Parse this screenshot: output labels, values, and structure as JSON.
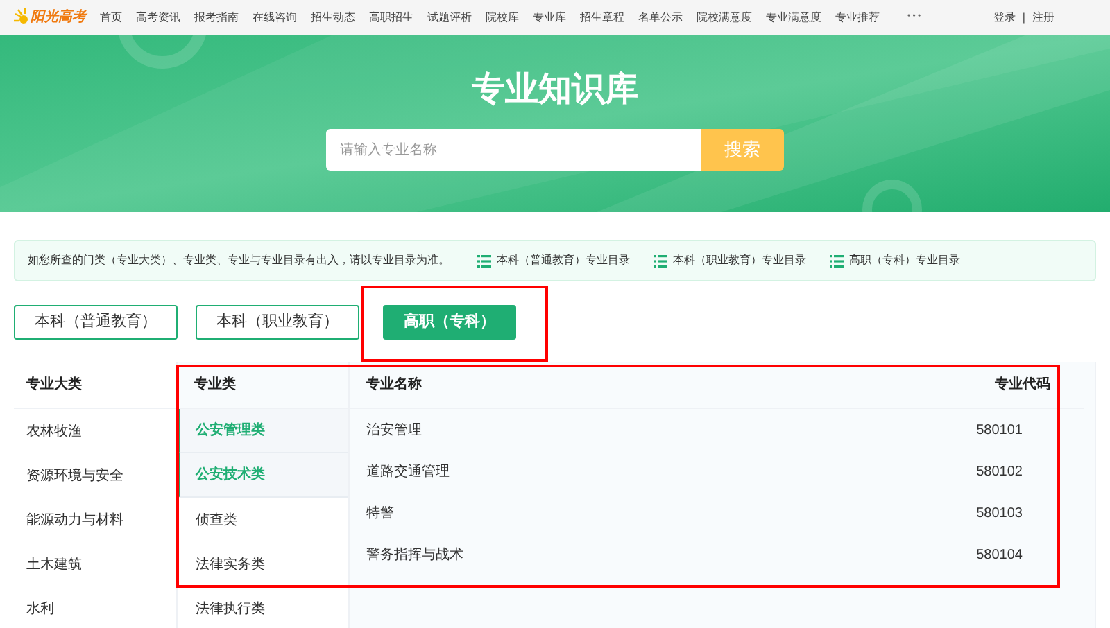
{
  "logo": {
    "text": "阳光高考"
  },
  "nav": [
    {
      "label": "首页"
    },
    {
      "label": "高考资讯"
    },
    {
      "label": "报考指南"
    },
    {
      "label": "在线咨询"
    },
    {
      "label": "招生动态"
    },
    {
      "label": "高职招生"
    },
    {
      "label": "试题评析"
    },
    {
      "label": "院校库"
    },
    {
      "label": "专业库"
    },
    {
      "label": "招生章程"
    },
    {
      "label": "名单公示"
    },
    {
      "label": "院校满意度"
    },
    {
      "label": "专业满意度"
    },
    {
      "label": "专业推荐"
    }
  ],
  "nav_more": "• • •",
  "auth": {
    "login": "登录",
    "separator": "|",
    "register": "注册"
  },
  "hero": {
    "title": "专业知识库",
    "search": {
      "placeholder": "请输入专业名称"
    },
    "search_button": "搜索"
  },
  "notice": {
    "text": "如您所查的门类（专业大类）、专业类、专业与专业目录有出入，请以专业目录为准。",
    "links": [
      {
        "label": "本科（普通教育）专业目录"
      },
      {
        "label": "本科（职业教育）专业目录"
      },
      {
        "label": "高职（专科）专业目录"
      }
    ]
  },
  "tabs": [
    {
      "label": "本科（普通教育）",
      "selected": false
    },
    {
      "label": "本科（职业教育）",
      "selected": false
    },
    {
      "label": "高职（专科）",
      "selected": true
    }
  ],
  "table": {
    "columns": [
      "专业大类",
      "专业类",
      "专业名称",
      "专业代码"
    ],
    "categories": [
      {
        "label": "农林牧渔"
      },
      {
        "label": "资源环境与安全"
      },
      {
        "label": "能源动力与材料"
      },
      {
        "label": "土木建筑"
      },
      {
        "label": "水利"
      }
    ],
    "subcategories": [
      {
        "label": "公安管理类",
        "selected": true
      },
      {
        "label": "公安技术类",
        "selected": true
      },
      {
        "label": "侦查类",
        "selected": false
      },
      {
        "label": "法律实务类",
        "selected": false
      },
      {
        "label": "法律执行类",
        "selected": false
      }
    ],
    "majors": [
      {
        "name": "治安管理",
        "code": "580101"
      },
      {
        "name": "道路交通管理",
        "code": "580102"
      },
      {
        "name": "特警",
        "code": "580103"
      },
      {
        "name": "警务指挥与战术",
        "code": "580104"
      }
    ]
  }
}
